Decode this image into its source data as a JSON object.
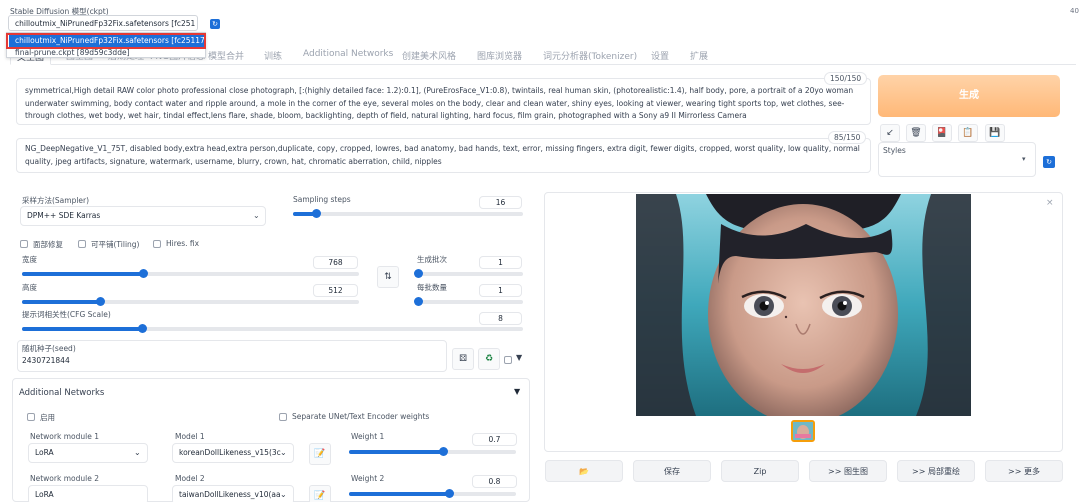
{
  "model": {
    "label": "Stable Diffusion 模型(ckpt)",
    "selected": "chilloutmix_NiPrunedFp32Fix.safetensors [fc251",
    "refresh_icon": "refresh-icon",
    "options": [
      "chilloutmix_NiPrunedFp32Fix.safetensors [fc2511737a]",
      "final-prune.ckpt [89d59c3dde]"
    ]
  },
  "tabs": [
    {
      "label": "文生图",
      "active": true
    },
    {
      "label": "图生图"
    },
    {
      "label": "后期处理"
    },
    {
      "label": "PNG图片信息"
    },
    {
      "label": "模型合并"
    },
    {
      "label": "训练"
    },
    {
      "label": "Additional Networks"
    },
    {
      "label": "创建美术风格"
    },
    {
      "label": "图库浏览器"
    },
    {
      "label": "词元分析器(Tokenizer)"
    },
    {
      "label": "设置"
    },
    {
      "label": "扩展"
    }
  ],
  "prompt": {
    "counter": "150/150",
    "text": "symmetrical,High detail RAW color photo professional close photograph, [:(highly detailed face: 1.2):0.1], (PureErosFace_V1:0.8), twintails, real human skin, (photorealistic:1.4), half body, pore, a portrait of a 20yo woman underwater swimming, body contact water and ripple around, a mole in the corner of the eye, several moles on the body, clear and clean water, shiny eyes, looking at viewer, wearing tight sports top, wet clothes, see-through clothes, wet body, wet hair, tindal effect,lens flare, shade, bloom, backlighting, depth of field, natural lighting, hard focus, film grain, photographed with a Sony a9 II Mirrorless Camera"
  },
  "negative": {
    "counter": "85/150",
    "text": "NG_DeepNegative_V1_75T, disabled body,extra head,extra person,duplicate, copy, cropped, lowres, bad anatomy, bad hands, text, error, missing fingers, extra digit, fewer digits, cropped, worst quality, low quality, normal quality, jpeg artifacts, signature, watermark, username, blurry, crown, hat, chromatic aberration, child, nipples"
  },
  "generate": {
    "label": "生成"
  },
  "tools": [
    "↙",
    "🗑",
    "🎴",
    "📋",
    "💾"
  ],
  "styles": {
    "label": "Styles"
  },
  "sampler": {
    "label": "采样方法(Sampler)",
    "value": "DPM++ SDE Karras"
  },
  "steps": {
    "label": "Sampling steps",
    "value": "16",
    "fraction": 0.1
  },
  "checks": {
    "face": "面部修复",
    "tiling": "可平铺(Tiling)",
    "hires": "Hires. fix"
  },
  "width": {
    "label": "宽度",
    "value": "768",
    "fraction": 0.36
  },
  "height": {
    "label": "高度",
    "value": "512",
    "fraction": 0.23
  },
  "swap_icon": "⇅",
  "batch_count": {
    "label": "生成批次",
    "value": "1",
    "fraction": 0.0
  },
  "batch_size": {
    "label": "每批数量",
    "value": "1",
    "fraction": 0.0
  },
  "cfg": {
    "label": "提示词相关性(CFG Scale)",
    "value": "8",
    "fraction": 0.24
  },
  "seed": {
    "label": "随机种子(seed)",
    "value": "2430721844"
  },
  "addnet": {
    "title": "Additional Networks",
    "enable": "启用",
    "separate": "Separate UNet/Text Encoder weights",
    "modules": [
      {
        "module_label": "Network module 1",
        "module": "LoRA",
        "model_label": "Model 1",
        "model": "koreanDollLikeness_v15(3c",
        "weight_label": "Weight 1",
        "weight": "0.7",
        "fraction": 0.56
      },
      {
        "module_label": "Network module 2",
        "module": "LoRA",
        "model_label": "Model 2",
        "model": "taiwanDollLikeness_v10(aa",
        "weight_label": "Weight 2",
        "weight": "0.8",
        "fraction": 0.6
      }
    ]
  },
  "actions": [
    "📂",
    "保存",
    "Zip",
    ">> 图生图",
    ">> 局部重绘",
    ">> 更多"
  ],
  "side_digits": "40",
  "colors": {
    "accent": "#1d6fd8",
    "generate": "#ffb877",
    "highlight_outline": "#e53935"
  }
}
